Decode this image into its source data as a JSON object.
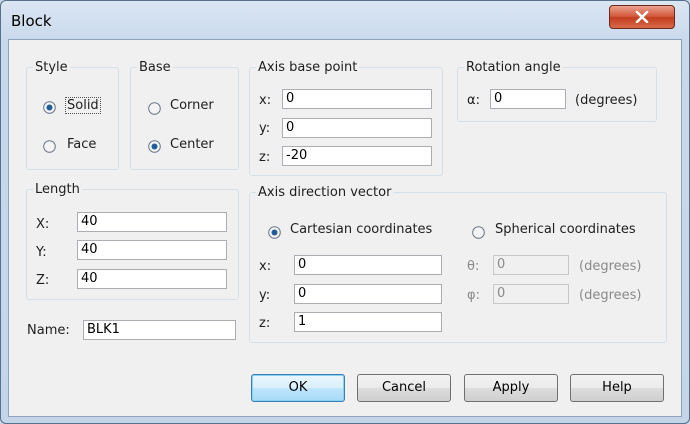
{
  "window": {
    "title": "Block"
  },
  "style": {
    "legend": "Style",
    "options": [
      {
        "label": "Solid",
        "checked": true
      },
      {
        "label": "Face",
        "checked": false
      }
    ]
  },
  "base": {
    "legend": "Base",
    "options": [
      {
        "label": "Corner",
        "checked": false
      },
      {
        "label": "Center",
        "checked": true
      }
    ]
  },
  "axis_base_point": {
    "legend": "Axis base point",
    "x_label": "x:",
    "x_value": "0",
    "y_label": "y:",
    "y_value": "0",
    "z_label": "z:",
    "z_value": "-20"
  },
  "rotation": {
    "legend": "Rotation angle",
    "label": "α:",
    "value": "0",
    "unit": "(degrees)"
  },
  "length": {
    "legend": "Length",
    "x_label": "X:",
    "x_value": "40",
    "y_label": "Y:",
    "y_value": "40",
    "z_label": "Z:",
    "z_value": "40"
  },
  "axis_direction": {
    "legend": "Axis direction vector",
    "cartesian_label": "Cartesian coordinates",
    "cartesian_checked": true,
    "spherical_label": "Spherical coordinates",
    "spherical_checked": false,
    "x_label": "x:",
    "x_value": "0",
    "y_label": "y:",
    "y_value": "0",
    "z_label": "z:",
    "z_value": "1",
    "theta_label": "θ:",
    "theta_value": "0",
    "theta_unit": "(degrees)",
    "phi_label": "φ:",
    "phi_value": "0",
    "phi_unit": "(degrees)"
  },
  "name": {
    "label": "Name:",
    "value": "BLK1"
  },
  "buttons": {
    "ok": "OK",
    "cancel": "Cancel",
    "apply": "Apply",
    "help": "Help"
  },
  "icons": {
    "close": "close-icon",
    "radio_checked": "radio-checked-icon",
    "radio_unchecked": "radio-unchecked-icon"
  },
  "colors": {
    "titlebar": "#c9d9ec",
    "close_button": "#c7472a",
    "default_button_border": "#3c7fb1",
    "dialog_background": "#f0f0f0"
  }
}
